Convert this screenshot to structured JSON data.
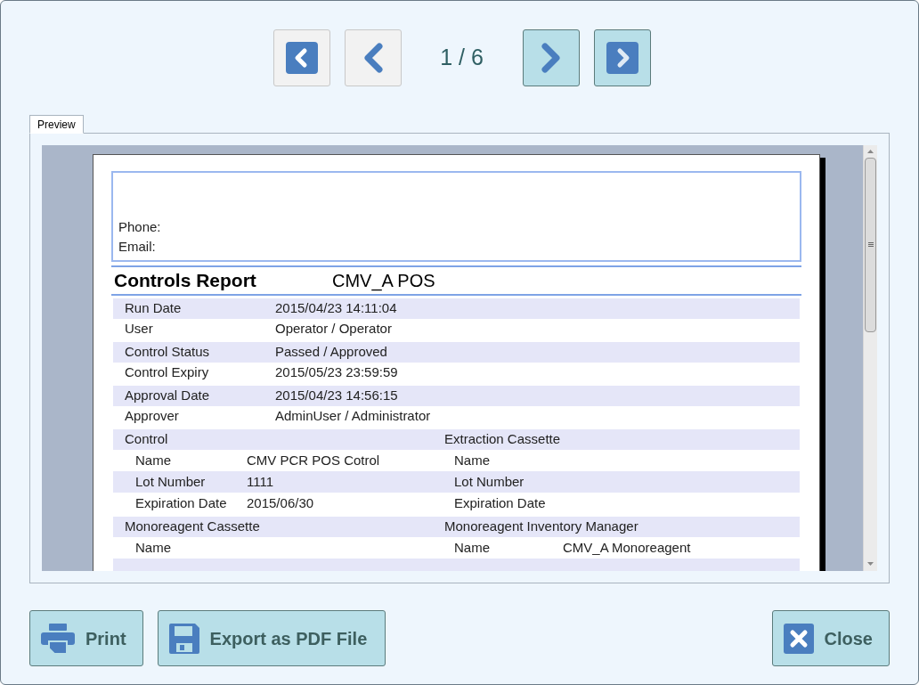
{
  "navigation": {
    "buttons": [
      {
        "kind": "first",
        "disabled": true
      },
      {
        "kind": "previous",
        "disabled": true
      },
      {
        "kind": "next",
        "disabled": false
      },
      {
        "kind": "last",
        "disabled": false
      }
    ],
    "page_indicator": "1 / 6"
  },
  "tabs": [
    {
      "label": "Preview",
      "selected": true
    }
  ],
  "report": {
    "header_lines": [
      "Phone:",
      "Email:"
    ],
    "title": "Controls Report",
    "subtitle": "CMV_A POS",
    "groups": [
      {
        "kind": "fields",
        "rows": [
          {
            "label": "Run Date",
            "value": "2015/04/23 14:11:04"
          },
          {
            "label": "User",
            "value": "Operator / Operator"
          }
        ]
      },
      {
        "kind": "fields",
        "rows": [
          {
            "label": "Control Status",
            "value": "Passed / Approved"
          },
          {
            "label": "Control Expiry",
            "value": "2015/05/23 23:59:59"
          }
        ]
      },
      {
        "kind": "fields",
        "rows": [
          {
            "label": "Approval Date",
            "value": "2015/04/23 14:56:15"
          },
          {
            "label": "Approver",
            "value": "AdminUser / Administrator"
          }
        ]
      },
      {
        "kind": "columns",
        "left": {
          "title": "Control",
          "rows": [
            {
              "label": "Name",
              "value": "CMV PCR POS Cotrol"
            },
            {
              "label": "Lot Number",
              "value": "1111"
            },
            {
              "label": "Expiration Date",
              "value": "2015/06/30"
            }
          ]
        },
        "right": {
          "title": "Extraction Cassette",
          "rows": [
            {
              "label": "Name"
            },
            {
              "label": "Lot Number"
            },
            {
              "label": "Expiration Date"
            }
          ]
        }
      },
      {
        "kind": "columns",
        "left": {
          "title": "Monoreagent Cassette",
          "rows": [
            {
              "label": "Name"
            }
          ]
        },
        "right": {
          "title": "Monoreagent Inventory Manager",
          "rows": [
            {
              "label": "Name",
              "value": "CMV_A Monoreagent"
            }
          ]
        }
      }
    ]
  },
  "actions": [
    {
      "kind": "print",
      "label": "Print"
    },
    {
      "kind": "export",
      "label": "Export as PDF File"
    },
    {
      "kind": "close",
      "label": "Close"
    }
  ]
}
